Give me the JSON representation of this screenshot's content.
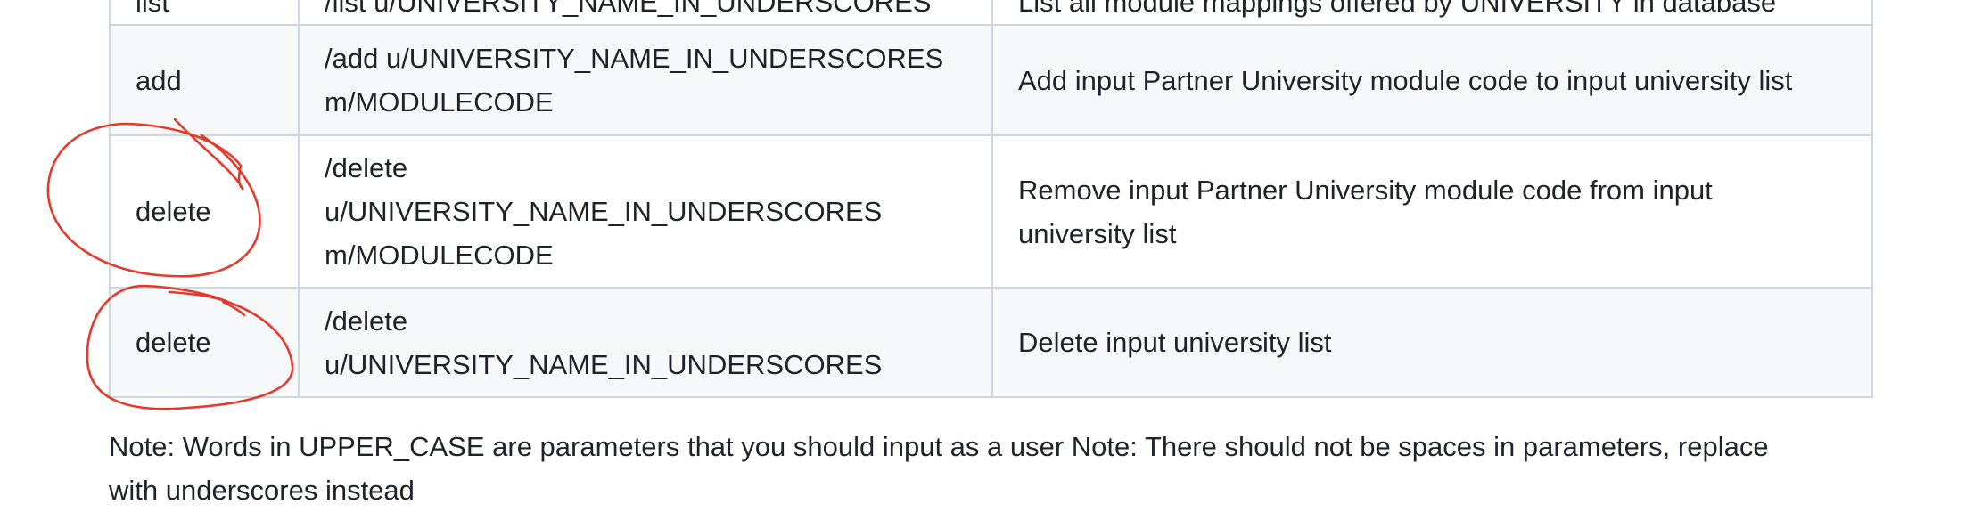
{
  "table": {
    "rows": [
      {
        "command": "list",
        "format": [
          "/list u/UNIVERSITY_NAME_IN_UNDERSCORES"
        ],
        "description": [
          "List all module mappings offered by UNIVERSITY in database"
        ]
      },
      {
        "command": "add",
        "format": [
          "/add u/UNIVERSITY_NAME_IN_UNDERSCORES",
          "m/MODULECODE"
        ],
        "description": [
          "Add input Partner University module code to input university list"
        ]
      },
      {
        "command": "delete",
        "format": [
          "/delete",
          "u/UNIVERSITY_NAME_IN_UNDERSCORES",
          "m/MODULECODE"
        ],
        "description": [
          "Remove input Partner University module code from input",
          "university list"
        ]
      },
      {
        "command": "delete",
        "format": [
          "/delete",
          "u/UNIVERSITY_NAME_IN_UNDERSCORES"
        ],
        "description": [
          "Delete input university list"
        ]
      }
    ]
  },
  "note": {
    "lines": [
      "Note: Words in UPPER_CASE are parameters that you should input as a user Note: There should not be spaces in parameters, replace",
      "with underscores instead"
    ]
  },
  "annotation": {
    "stroke_color": "#e53a2b",
    "shape": "hand-drawn circles around delete commands"
  },
  "colors": {
    "border": "#d0d7de",
    "row_alt": "#f6f8fa",
    "text": "#1f2328"
  }
}
